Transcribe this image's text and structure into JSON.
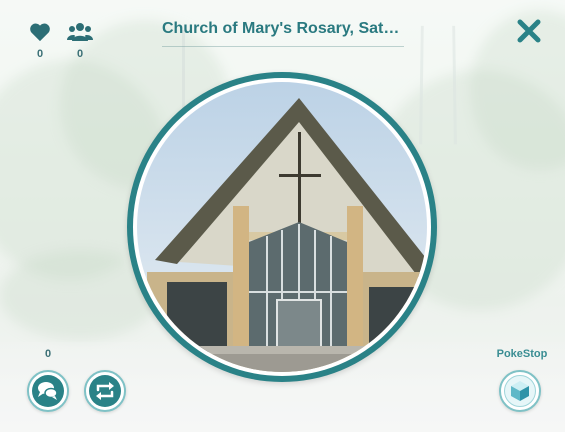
{
  "stop": {
    "title": "Church of Mary's Rosary, Satt…",
    "likes": "0",
    "members": "0",
    "comments": "0",
    "type_label": "PokeStop"
  },
  "icons": {
    "likes": "heart-icon",
    "members": "people-icon",
    "close": "close-icon",
    "chat": "chat-icon",
    "share": "share-icon",
    "stop": "cube-icon"
  },
  "colors": {
    "accent": "#2a8287",
    "ring_light": "#7fc2c6",
    "title": "#2a7a80"
  }
}
